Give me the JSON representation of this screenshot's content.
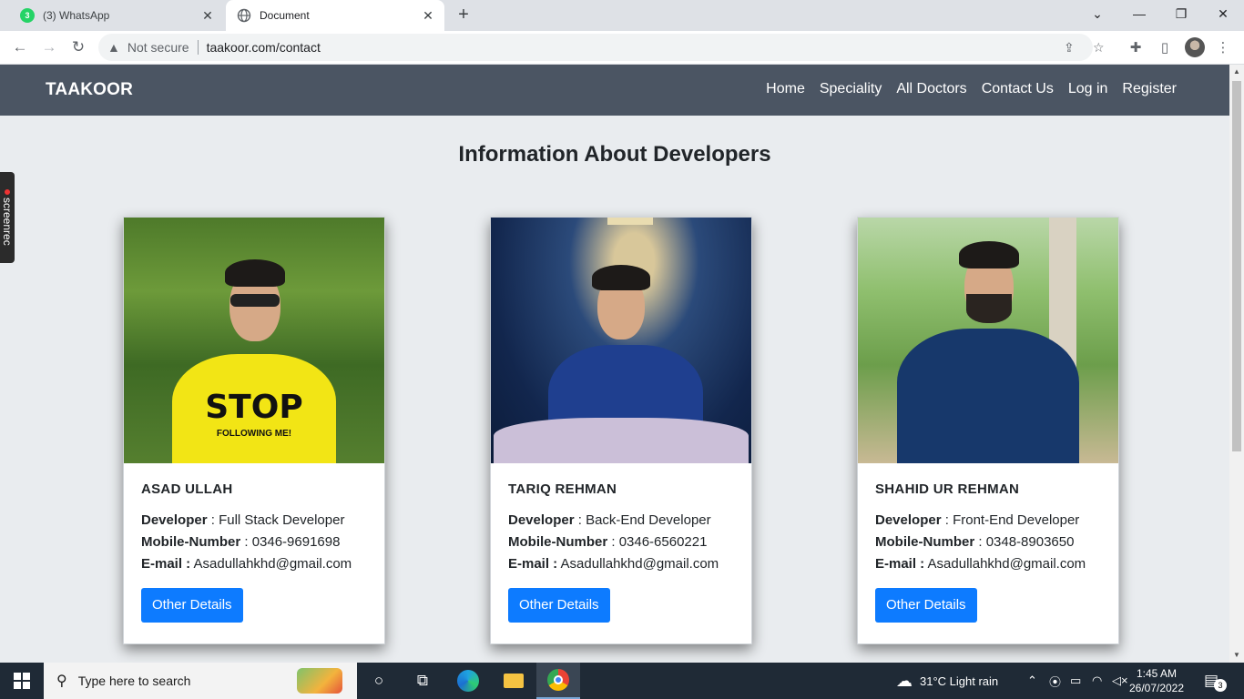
{
  "browser": {
    "tabs": [
      {
        "title": "(3) WhatsApp",
        "badge": "3",
        "close": "✕"
      },
      {
        "title": "Document",
        "close": "✕"
      }
    ],
    "new_tab": "+",
    "address": {
      "security": "Not secure",
      "url": "taakoor.com/contact"
    }
  },
  "site": {
    "brand": "TAAKOOR",
    "nav": [
      "Home",
      "Speciality",
      "All Doctors",
      "Contact Us",
      "Log in",
      "Register"
    ]
  },
  "page": {
    "title": "Information About Developers",
    "labels": {
      "role": "Developer",
      "mobile": "Mobile-Number",
      "email": "E-mail :"
    },
    "developers": [
      {
        "name": "ASAD ULLAH",
        "role": "Full Stack Developer",
        "mobile": "0346-9691698",
        "email": "Asadullahkhd@gmail.com",
        "button": "Other Details",
        "shirt_text": "STOP",
        "shirt_subtext": "FOLLOWING ME!"
      },
      {
        "name": "TARIQ REHMAN",
        "role": "Back-End Developer",
        "mobile": "0346-6560221",
        "email": "Asadullahkhd@gmail.com",
        "button": "Other Details"
      },
      {
        "name": "SHAHID UR REHMAN",
        "role": "Front-End Developer",
        "mobile": "0348-8903650",
        "email": "Asadullahkhd@gmail.com",
        "button": "Other Details"
      }
    ]
  },
  "overlay": {
    "screenrec": "screenrec"
  },
  "taskbar": {
    "search_placeholder": "Type here to search",
    "weather": "31°C  Light rain",
    "time": "1:45 AM",
    "date": "26/07/2022",
    "notifications": "3"
  }
}
